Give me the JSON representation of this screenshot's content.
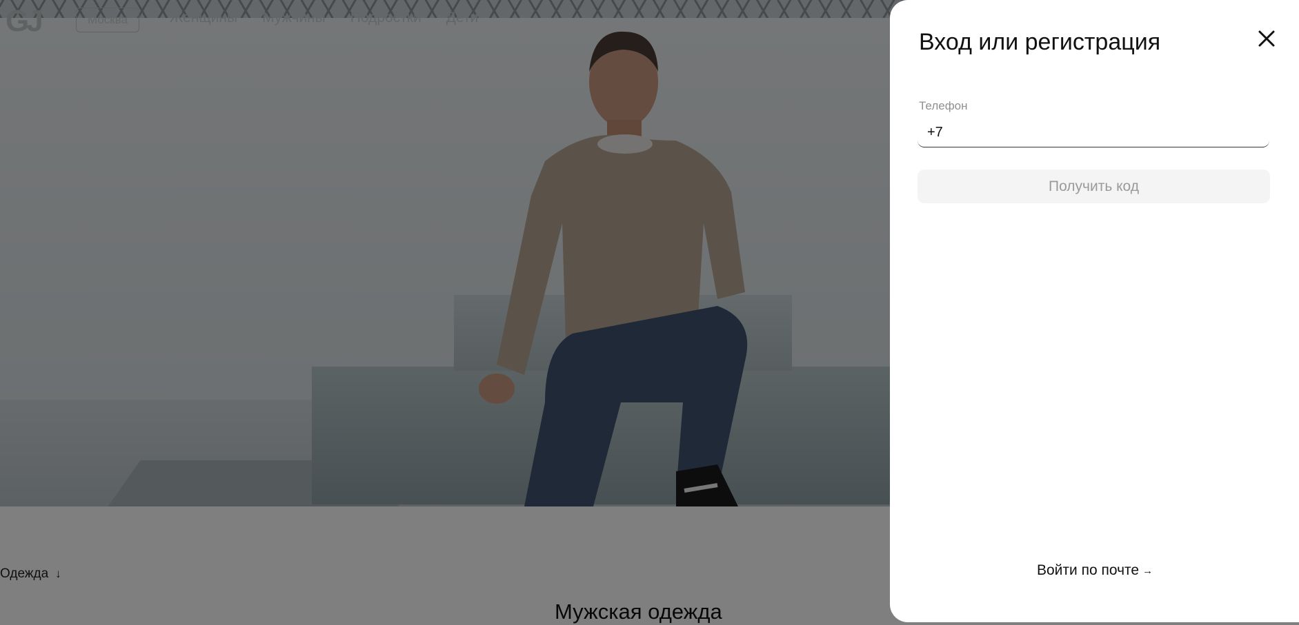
{
  "header": {
    "logo": "GJ",
    "city": "Москва",
    "nav": [
      "Женщины",
      "Мужчины",
      "Подростки",
      "Дети"
    ]
  },
  "filter": {
    "label": "Одежда",
    "icon": "arrow-down-icon"
  },
  "section": {
    "title": "Мужская одежда"
  },
  "modal": {
    "title": "Вход или регистрация",
    "close_icon": "close-icon",
    "phone": {
      "label": "Телефон",
      "value": "+7"
    },
    "get_code_label": "Получить код",
    "email_login_label": "Войти по почте",
    "email_login_icon": "arrow-right-icon"
  },
  "colors": {
    "overlay": "rgba(0,0,0,0.5)",
    "modal_bg": "#ffffff",
    "disabled_button_bg": "#f4f4f4",
    "disabled_button_text": "#9a9a9a"
  }
}
